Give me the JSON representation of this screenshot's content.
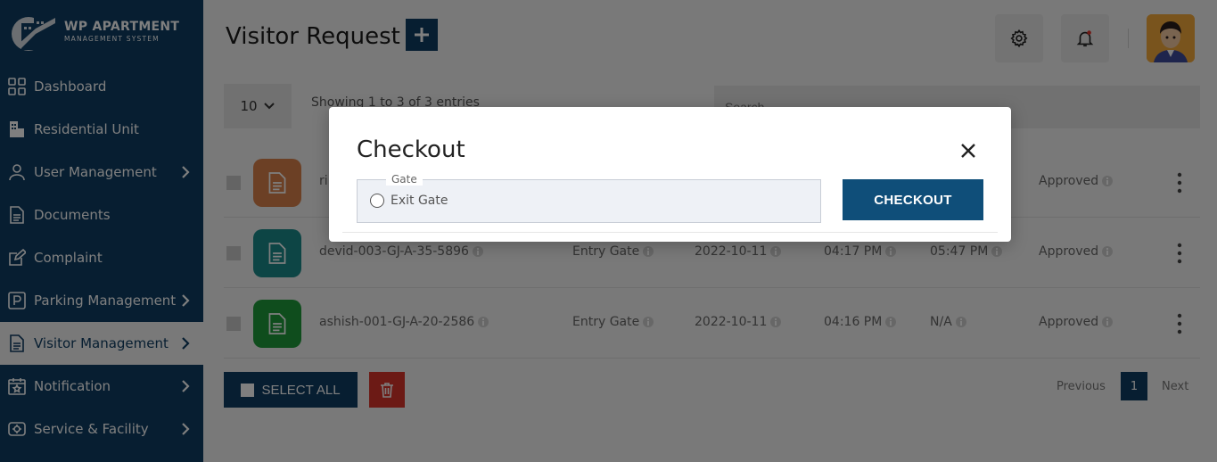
{
  "brand": {
    "title": "WP APARTMENT",
    "subtitle": "MANAGEMENT SYSTEM"
  },
  "sidebar": {
    "items": [
      {
        "label": "Dashboard",
        "icon": "grid-icon"
      },
      {
        "label": "Residential Unit",
        "icon": "building-icon"
      },
      {
        "label": "User Management",
        "icon": "user-icon"
      },
      {
        "label": "Documents",
        "icon": "document-icon"
      },
      {
        "label": "Complaint",
        "icon": "edit-icon"
      },
      {
        "label": "Parking Management",
        "icon": "parking-icon"
      },
      {
        "label": "Visitor Management",
        "icon": "visitor-doc-icon"
      },
      {
        "label": "Notification",
        "icon": "calendar-star-icon"
      },
      {
        "label": "Service & Facility",
        "icon": "service-icon"
      }
    ]
  },
  "header": {
    "title": "Visitor Request",
    "add_label": "+"
  },
  "toolbar": {
    "page_length": "10",
    "showing": "Showing 1 to 3 of 3 entries",
    "search_placeholder": "Search..."
  },
  "table": {
    "rows": [
      {
        "name": "ri",
        "gate": "",
        "date": "",
        "in_time": "",
        "out_time": "",
        "status": "Approved",
        "color": "#d9804a"
      },
      {
        "name": "devid-003-GJ-A-35-5896",
        "gate": "Entry Gate",
        "date": "2022-10-11",
        "in_time": "04:17 PM",
        "out_time": "05:47 PM",
        "status": "Approved",
        "color": "#1a8a8a"
      },
      {
        "name": "ashish-001-GJ-A-20-2586",
        "gate": "Entry Gate",
        "date": "2022-10-11",
        "in_time": "04:16 PM",
        "out_time": "N/A",
        "status": "Approved",
        "color": "#1e9a3a"
      }
    ]
  },
  "bulk": {
    "select_all": "SELECT ALL"
  },
  "pagination": {
    "previous": "Previous",
    "current": "1",
    "next": "Next"
  },
  "modal": {
    "title": "Checkout",
    "gate_legend": "Gate",
    "gate_option": "Exit Gate",
    "checkout_label": "CHECKOUT"
  },
  "colors": {
    "primary": "#0f3d62",
    "danger": "#d9342b"
  }
}
